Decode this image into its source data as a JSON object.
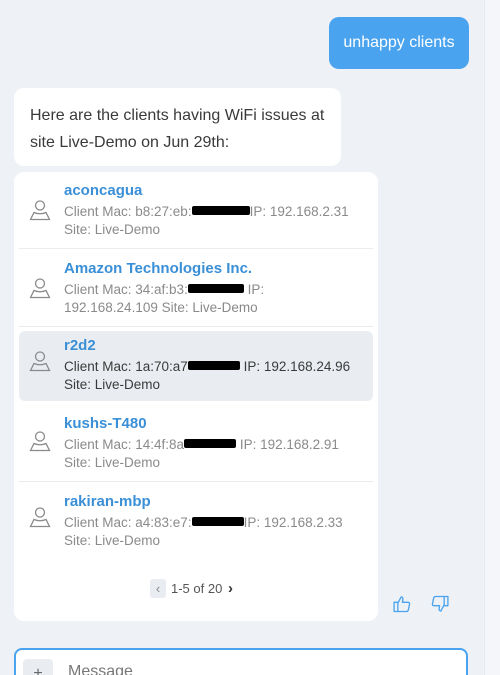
{
  "user_message": "unhappy clients",
  "bot_message": "Here are the clients having WiFi issues at site Live-Demo on Jun 29th:",
  "clients": [
    {
      "name": "aconcagua",
      "mac_prefix": "Client Mac: b8:27:eb:",
      "ip_text": "IP: 192.168.2.31",
      "site": "Site: Live-Demo"
    },
    {
      "name": "Amazon Technologies Inc.",
      "mac_prefix": "Client Mac: 34:af:b3:",
      "ip_text": "IP:",
      "site": "192.168.24.109 Site: Live-Demo"
    },
    {
      "name": "r2d2",
      "mac_prefix": "Client Mac: 1a:70:a7",
      "ip_text": "IP: 192.168.24.96",
      "site": "Site: Live-Demo"
    },
    {
      "name": "kushs-T480",
      "mac_prefix": "Client Mac: 14:4f:8a",
      "ip_text": "IP: 192.168.2.91",
      "site": "Site: Live-Demo"
    },
    {
      "name": "rakiran-mbp",
      "mac_prefix": "Client Mac: a4:83:e7:",
      "ip_text": "IP: 192.168.2.33",
      "site": "Site: Live-Demo"
    }
  ],
  "pagination": {
    "prev": "‹",
    "label": "1-5 of 20",
    "next": "›"
  },
  "composer": {
    "plus": "+",
    "placeholder": "Message"
  },
  "colors": {
    "accent": "#4aa3ee",
    "link": "#3a8fd6",
    "background": "#eef1f5"
  },
  "icons": {
    "client": "user-icon",
    "like": "thumbs-up-icon",
    "dislike": "thumbs-down-icon"
  }
}
